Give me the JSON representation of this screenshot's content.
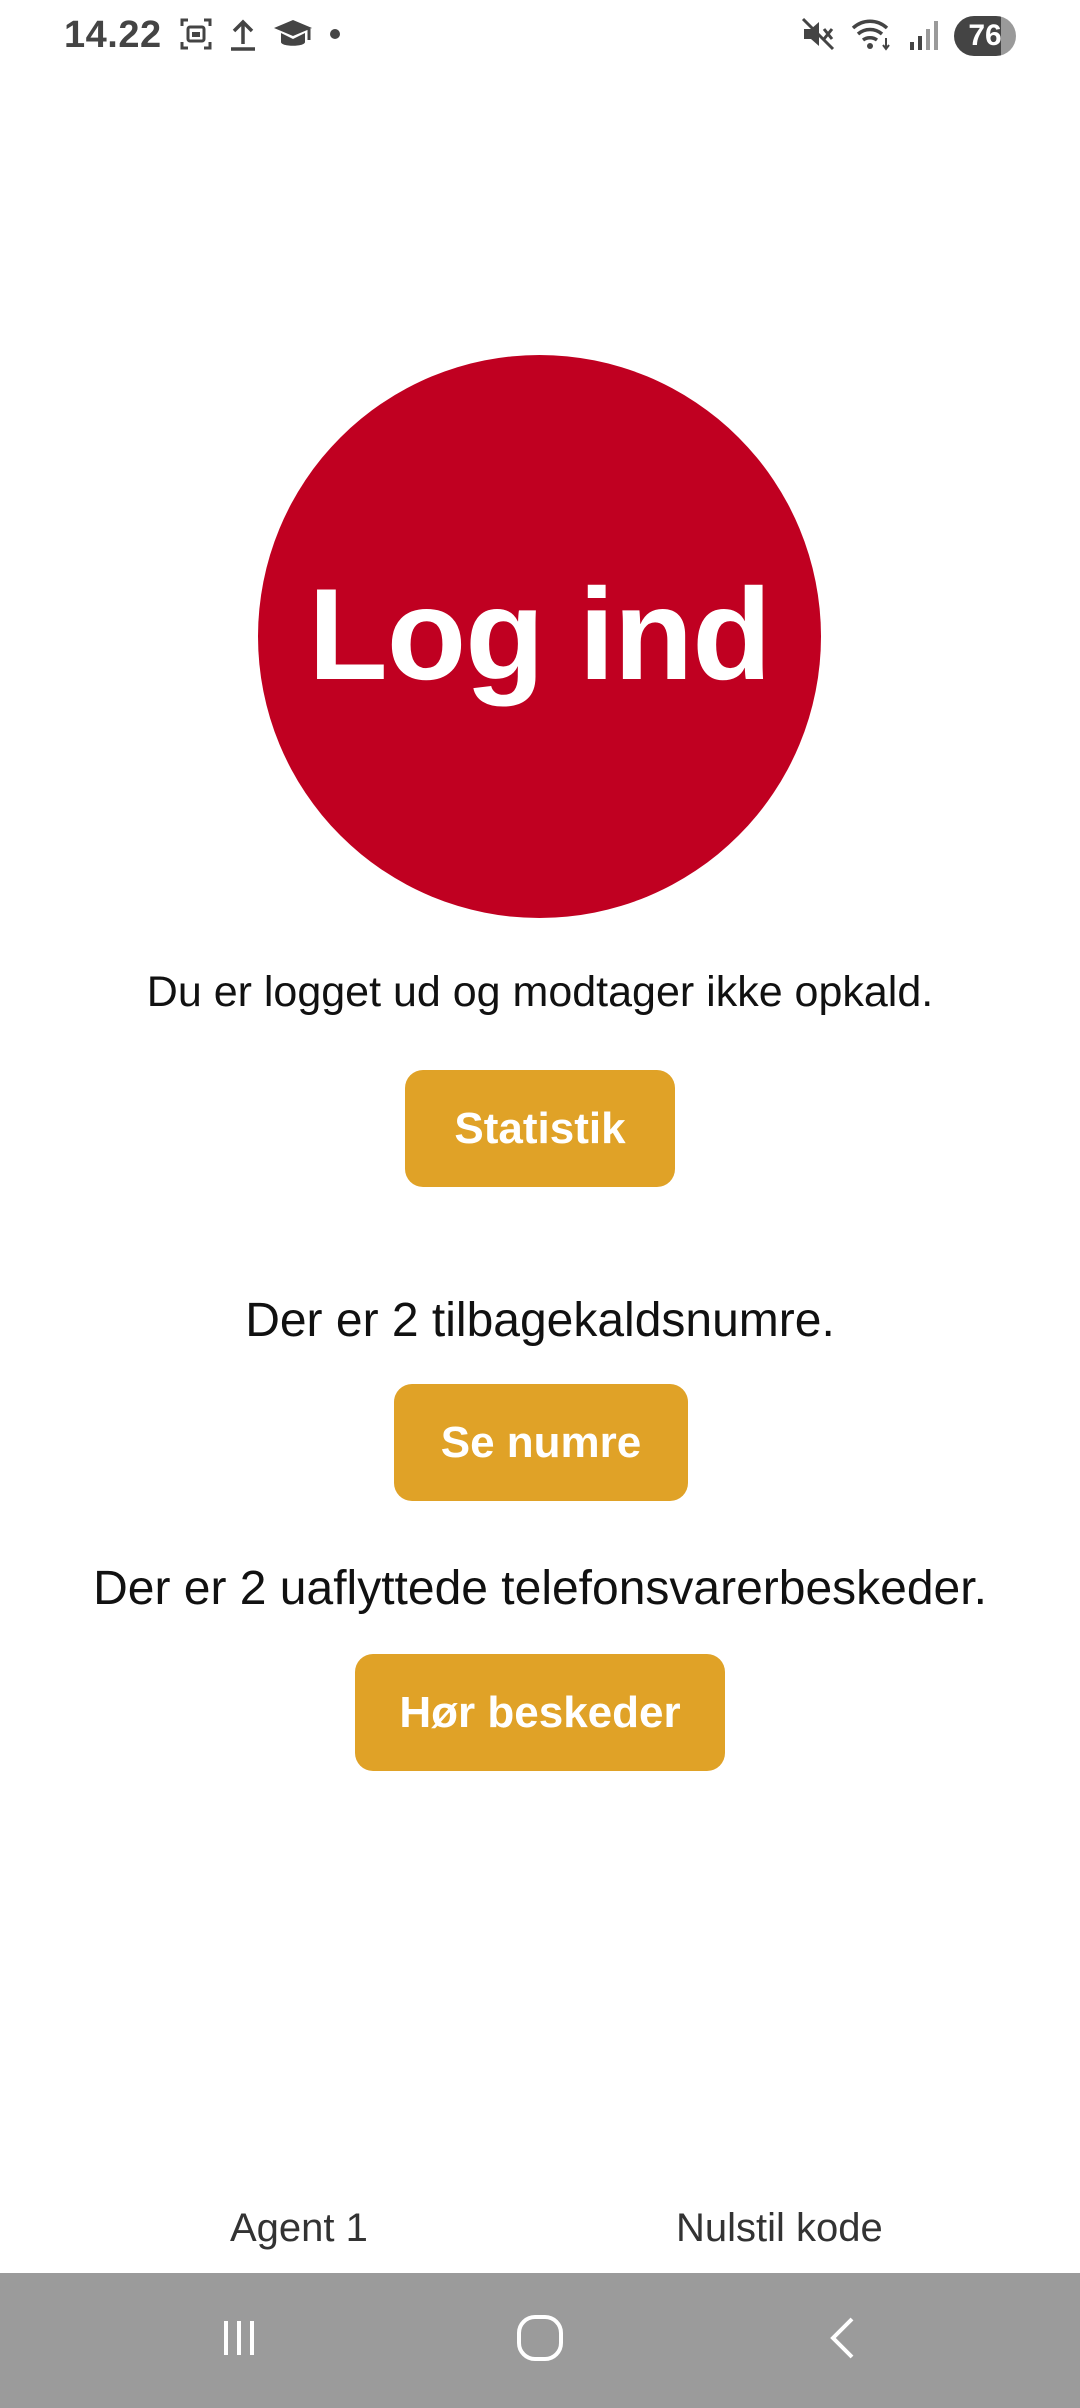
{
  "status_bar": {
    "time": "14.22",
    "battery_level": "76",
    "icons_left": [
      "screenshot-icon",
      "upload-icon",
      "graduation-cap-icon",
      "notification-dot-icon"
    ],
    "icons_right": [
      "mute-icon",
      "wifi-icon",
      "signal-icon",
      "battery-icon"
    ]
  },
  "main": {
    "login_button_label": "Log ind",
    "status_message": "Du er logget ud og modtager ikke opkald.",
    "statistics_button_label": "Statistik",
    "callback_message": "Der er 2 tilbagekaldsnumre.",
    "see_numbers_button_label": "Se numre",
    "voicemail_message": "Der er 2 uaflyttede telefonsvarerbeskeder.",
    "listen_messages_button_label": "Hør beskeder"
  },
  "footer": {
    "agent_label": "Agent 1",
    "reset_code_label": "Nulstil kode"
  },
  "nav_bar": {
    "icons": [
      "recent-apps-icon",
      "home-icon",
      "back-icon"
    ]
  },
  "colors": {
    "login_red": "#c00021",
    "button_gold": "#e0a227",
    "nav_gray": "#9b9b9b"
  }
}
